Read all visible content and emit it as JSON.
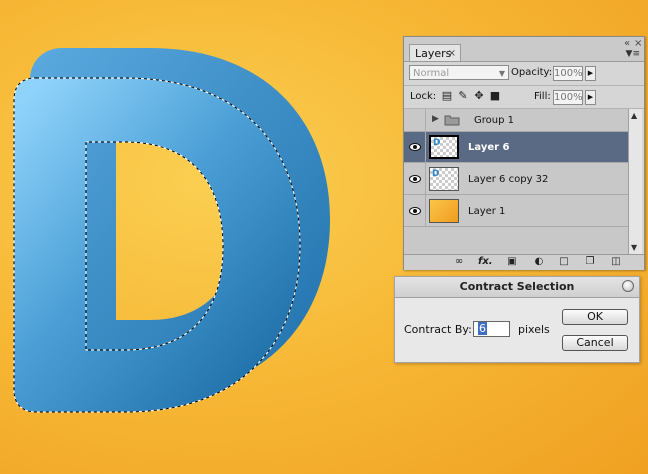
{
  "canvas": {
    "letter": "D",
    "background_color": "#f7b937",
    "letter_colors": {
      "light": "#8fd3fb",
      "dark": "#1c6ca6"
    }
  },
  "layers_panel": {
    "tab_label": "Layers",
    "tab_close_glyph": "×",
    "window_minimize": "«",
    "window_close": "×",
    "blend_mode": "Normal",
    "opacity_label": "Opacity:",
    "opacity_value": "100%",
    "lock_label": "Lock:",
    "fill_label": "Fill:",
    "fill_value": "100%",
    "layers": [
      {
        "name": "Group 1",
        "type": "group",
        "visible": false,
        "selected": false
      },
      {
        "name": "Layer 6",
        "type": "transparent",
        "visible": true,
        "selected": true
      },
      {
        "name": "Layer 6 copy 32",
        "type": "transparent",
        "visible": true,
        "selected": false
      },
      {
        "name": "Layer 1",
        "type": "orange",
        "visible": true,
        "selected": false
      }
    ],
    "bottom_icons": [
      "link-icon",
      "fx-icon",
      "mask-icon",
      "adjustment-icon",
      "folder-icon",
      "new-layer-icon",
      "trash-icon"
    ],
    "fx_label": "fx."
  },
  "contract_dialog": {
    "title": "Contract Selection",
    "field_label": "Contract By:",
    "field_value": "6",
    "unit": "pixels",
    "ok_label": "OK",
    "cancel_label": "Cancel"
  }
}
